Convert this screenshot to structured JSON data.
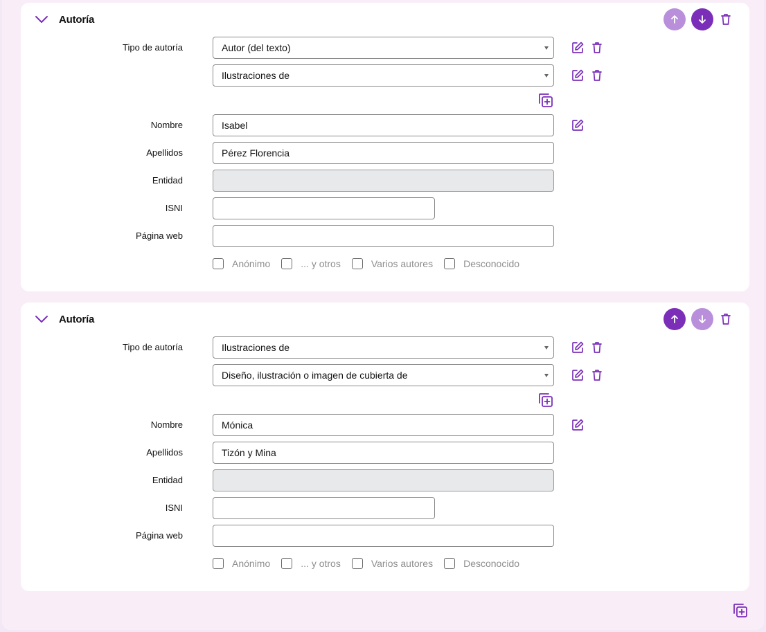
{
  "colors": {
    "accent": "#7b2fb8",
    "accent_light": "#b98fdb",
    "page_bg": "#f9eef8",
    "card_bg": "#ffffff",
    "disabled_field_bg": "#e7e9eb"
  },
  "icons": {
    "collapse": "chevron-down-icon",
    "move_up": "arrow-up-icon",
    "move_down": "arrow-down-icon",
    "delete": "trash-icon",
    "edit": "edit-icon",
    "add_copy": "add-copy-icon"
  },
  "labels": {
    "tipo": "Tipo de autoría",
    "nombre": "Nombre",
    "apellidos": "Apellidos",
    "entidad": "Entidad",
    "isni": "ISNI",
    "web": "Página web",
    "check_anonimo": "Anónimo",
    "check_otros": "... y otros",
    "check_varios": "Varios autores",
    "check_desconocido": "Desconocido"
  },
  "authorships": [
    {
      "title": "Autoría",
      "tipos": [
        "Autor (del texto)",
        "Ilustraciones de"
      ],
      "nombre": "Isabel",
      "apellidos": "Pérez Florencia",
      "entidad": "",
      "isni": "",
      "web": ""
    },
    {
      "title": "Autoría",
      "tipos": [
        "Ilustraciones de",
        "Diseño, ilustración o imagen de cubierta de"
      ],
      "nombre": "Mónica",
      "apellidos": "Tizón y Mina",
      "entidad": "",
      "isni": "",
      "web": ""
    }
  ]
}
